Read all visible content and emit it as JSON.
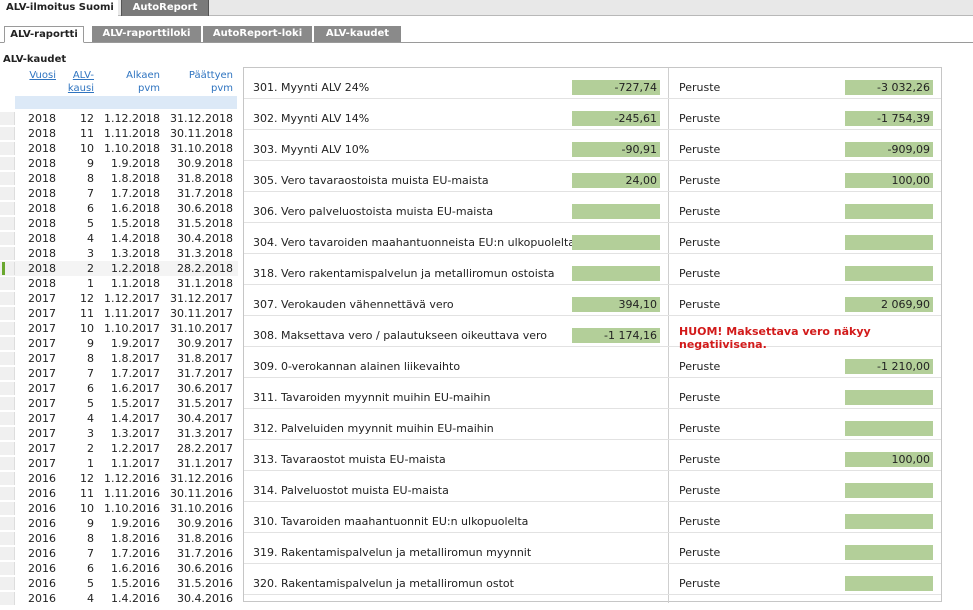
{
  "top_tabs": {
    "active": "ALV-ilmoitus Suomi",
    "inactive": "AutoReport"
  },
  "sub_tabs": [
    "ALV-raportti",
    "ALV-raporttiloki",
    "AutoReport-loki",
    "ALV-kaudet"
  ],
  "section_title": "ALV-kaudet",
  "table_headers": {
    "vuosi": "Vuosi",
    "kausi1": "ALV-",
    "kausi2": "kausi",
    "alkaen1": "Alkaen",
    "alkaen2": "pvm",
    "paattyen1": "Päättyen",
    "paattyen2": "pvm"
  },
  "periods": [
    [
      "2018",
      "12",
      "1.12.2018",
      "31.12.2018"
    ],
    [
      "2018",
      "11",
      "1.11.2018",
      "30.11.2018"
    ],
    [
      "2018",
      "10",
      "1.10.2018",
      "31.10.2018"
    ],
    [
      "2018",
      "9",
      "1.9.2018",
      "30.9.2018"
    ],
    [
      "2018",
      "8",
      "1.8.2018",
      "31.8.2018"
    ],
    [
      "2018",
      "7",
      "1.7.2018",
      "31.7.2018"
    ],
    [
      "2018",
      "6",
      "1.6.2018",
      "30.6.2018"
    ],
    [
      "2018",
      "5",
      "1.5.2018",
      "31.5.2018"
    ],
    [
      "2018",
      "4",
      "1.4.2018",
      "30.4.2018"
    ],
    [
      "2018",
      "3",
      "1.3.2018",
      "31.3.2018"
    ],
    [
      "2018",
      "2",
      "1.2.2018",
      "28.2.2018"
    ],
    [
      "2018",
      "1",
      "1.1.2018",
      "31.1.2018"
    ],
    [
      "2017",
      "12",
      "1.12.2017",
      "31.12.2017"
    ],
    [
      "2017",
      "11",
      "1.11.2017",
      "30.11.2017"
    ],
    [
      "2017",
      "10",
      "1.10.2017",
      "31.10.2017"
    ],
    [
      "2017",
      "9",
      "1.9.2017",
      "30.9.2017"
    ],
    [
      "2017",
      "8",
      "1.8.2017",
      "31.8.2017"
    ],
    [
      "2017",
      "7",
      "1.7.2017",
      "31.7.2017"
    ],
    [
      "2017",
      "6",
      "1.6.2017",
      "30.6.2017"
    ],
    [
      "2017",
      "5",
      "1.5.2017",
      "31.5.2017"
    ],
    [
      "2017",
      "4",
      "1.4.2017",
      "30.4.2017"
    ],
    [
      "2017",
      "3",
      "1.3.2017",
      "31.3.2017"
    ],
    [
      "2017",
      "2",
      "1.2.2017",
      "28.2.2017"
    ],
    [
      "2017",
      "1",
      "1.1.2017",
      "31.1.2017"
    ],
    [
      "2016",
      "12",
      "1.12.2016",
      "31.12.2016"
    ],
    [
      "2016",
      "11",
      "1.11.2016",
      "30.11.2016"
    ],
    [
      "2016",
      "10",
      "1.10.2016",
      "31.10.2016"
    ],
    [
      "2016",
      "9",
      "1.9.2016",
      "30.9.2016"
    ],
    [
      "2016",
      "8",
      "1.8.2016",
      "31.8.2016"
    ],
    [
      "2016",
      "7",
      "1.7.2016",
      "31.7.2016"
    ],
    [
      "2016",
      "6",
      "1.6.2016",
      "30.6.2016"
    ],
    [
      "2016",
      "5",
      "1.5.2016",
      "31.5.2016"
    ],
    [
      "2016",
      "4",
      "1.4.2016",
      "30.4.2016"
    ]
  ],
  "selected_index": 10,
  "peruste_label": "Peruste",
  "report_rows": [
    {
      "label": "301. Myynti ALV 24%",
      "value": "-727,74",
      "peruste": "-3 032,26"
    },
    {
      "label": "302. Myynti ALV 14%",
      "value": "-245,61",
      "peruste": "-1 754,39"
    },
    {
      "label": "303. Myynti ALV 10%",
      "value": "-90,91",
      "peruste": "-909,09"
    },
    {
      "label": "305. Vero tavaraostoista muista EU-maista",
      "value": "24,00",
      "peruste": "100,00"
    },
    {
      "label": "306. Vero palveluostoista muista EU-maista",
      "value": "",
      "peruste": ""
    },
    {
      "label": "304. Vero tavaroiden maahantuonneista EU:n ulkopuolelta",
      "value": "",
      "peruste": ""
    },
    {
      "label": "318. Vero rakentamispalvelun ja metalliromun ostoista",
      "value": "",
      "peruste": ""
    },
    {
      "label": "307. Verokauden vähennettävä vero",
      "value": "394,10",
      "peruste": "2 069,90"
    },
    {
      "label": "308. Maksettava vero / palautukseen oikeuttava vero",
      "value": "-1 174,16",
      "warning": "HUOM! Maksettava vero näkyy negatiivisena."
    },
    {
      "label": "309. 0-verokannan alainen liikevaihto",
      "peruste": "-1 210,00"
    },
    {
      "label": "311. Tavaroiden myynnit muihin EU-maihin",
      "peruste": ""
    },
    {
      "label": "312. Palveluiden myynnit muihin EU-maihin",
      "peruste": ""
    },
    {
      "label": "313. Tavaraostot muista EU-maista",
      "peruste": "100,00"
    },
    {
      "label": "314. Palveluostot muista EU-maista",
      "peruste": ""
    },
    {
      "label": "310. Tavaroiden maahantuonnit EU:n ulkopuolelta",
      "peruste": ""
    },
    {
      "label": "319. Rakentamispalvelun ja metalliromun myynnit",
      "peruste": ""
    },
    {
      "label": "320. Rakentamispalvelun ja metalliromun ostot",
      "peruste": ""
    }
  ],
  "colors": {
    "field_green": "#b3cf99",
    "warning_red": "#d21a1a",
    "link_blue": "#2f74c0",
    "tab_gray": "#8a8a8a"
  }
}
